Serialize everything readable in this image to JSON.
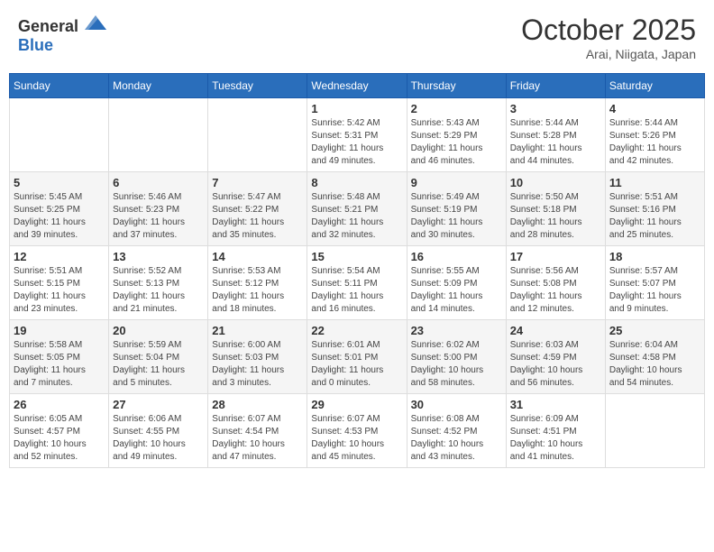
{
  "header": {
    "logo_general": "General",
    "logo_blue": "Blue",
    "month": "October 2025",
    "location": "Arai, Niigata, Japan"
  },
  "weekdays": [
    "Sunday",
    "Monday",
    "Tuesday",
    "Wednesday",
    "Thursday",
    "Friday",
    "Saturday"
  ],
  "weeks": [
    [
      {
        "day": "",
        "info": ""
      },
      {
        "day": "",
        "info": ""
      },
      {
        "day": "",
        "info": ""
      },
      {
        "day": "1",
        "info": "Sunrise: 5:42 AM\nSunset: 5:31 PM\nDaylight: 11 hours\nand 49 minutes."
      },
      {
        "day": "2",
        "info": "Sunrise: 5:43 AM\nSunset: 5:29 PM\nDaylight: 11 hours\nand 46 minutes."
      },
      {
        "day": "3",
        "info": "Sunrise: 5:44 AM\nSunset: 5:28 PM\nDaylight: 11 hours\nand 44 minutes."
      },
      {
        "day": "4",
        "info": "Sunrise: 5:44 AM\nSunset: 5:26 PM\nDaylight: 11 hours\nand 42 minutes."
      }
    ],
    [
      {
        "day": "5",
        "info": "Sunrise: 5:45 AM\nSunset: 5:25 PM\nDaylight: 11 hours\nand 39 minutes."
      },
      {
        "day": "6",
        "info": "Sunrise: 5:46 AM\nSunset: 5:23 PM\nDaylight: 11 hours\nand 37 minutes."
      },
      {
        "day": "7",
        "info": "Sunrise: 5:47 AM\nSunset: 5:22 PM\nDaylight: 11 hours\nand 35 minutes."
      },
      {
        "day": "8",
        "info": "Sunrise: 5:48 AM\nSunset: 5:21 PM\nDaylight: 11 hours\nand 32 minutes."
      },
      {
        "day": "9",
        "info": "Sunrise: 5:49 AM\nSunset: 5:19 PM\nDaylight: 11 hours\nand 30 minutes."
      },
      {
        "day": "10",
        "info": "Sunrise: 5:50 AM\nSunset: 5:18 PM\nDaylight: 11 hours\nand 28 minutes."
      },
      {
        "day": "11",
        "info": "Sunrise: 5:51 AM\nSunset: 5:16 PM\nDaylight: 11 hours\nand 25 minutes."
      }
    ],
    [
      {
        "day": "12",
        "info": "Sunrise: 5:51 AM\nSunset: 5:15 PM\nDaylight: 11 hours\nand 23 minutes."
      },
      {
        "day": "13",
        "info": "Sunrise: 5:52 AM\nSunset: 5:13 PM\nDaylight: 11 hours\nand 21 minutes."
      },
      {
        "day": "14",
        "info": "Sunrise: 5:53 AM\nSunset: 5:12 PM\nDaylight: 11 hours\nand 18 minutes."
      },
      {
        "day": "15",
        "info": "Sunrise: 5:54 AM\nSunset: 5:11 PM\nDaylight: 11 hours\nand 16 minutes."
      },
      {
        "day": "16",
        "info": "Sunrise: 5:55 AM\nSunset: 5:09 PM\nDaylight: 11 hours\nand 14 minutes."
      },
      {
        "day": "17",
        "info": "Sunrise: 5:56 AM\nSunset: 5:08 PM\nDaylight: 11 hours\nand 12 minutes."
      },
      {
        "day": "18",
        "info": "Sunrise: 5:57 AM\nSunset: 5:07 PM\nDaylight: 11 hours\nand 9 minutes."
      }
    ],
    [
      {
        "day": "19",
        "info": "Sunrise: 5:58 AM\nSunset: 5:05 PM\nDaylight: 11 hours\nand 7 minutes."
      },
      {
        "day": "20",
        "info": "Sunrise: 5:59 AM\nSunset: 5:04 PM\nDaylight: 11 hours\nand 5 minutes."
      },
      {
        "day": "21",
        "info": "Sunrise: 6:00 AM\nSunset: 5:03 PM\nDaylight: 11 hours\nand 3 minutes."
      },
      {
        "day": "22",
        "info": "Sunrise: 6:01 AM\nSunset: 5:01 PM\nDaylight: 11 hours\nand 0 minutes."
      },
      {
        "day": "23",
        "info": "Sunrise: 6:02 AM\nSunset: 5:00 PM\nDaylight: 10 hours\nand 58 minutes."
      },
      {
        "day": "24",
        "info": "Sunrise: 6:03 AM\nSunset: 4:59 PM\nDaylight: 10 hours\nand 56 minutes."
      },
      {
        "day": "25",
        "info": "Sunrise: 6:04 AM\nSunset: 4:58 PM\nDaylight: 10 hours\nand 54 minutes."
      }
    ],
    [
      {
        "day": "26",
        "info": "Sunrise: 6:05 AM\nSunset: 4:57 PM\nDaylight: 10 hours\nand 52 minutes."
      },
      {
        "day": "27",
        "info": "Sunrise: 6:06 AM\nSunset: 4:55 PM\nDaylight: 10 hours\nand 49 minutes."
      },
      {
        "day": "28",
        "info": "Sunrise: 6:07 AM\nSunset: 4:54 PM\nDaylight: 10 hours\nand 47 minutes."
      },
      {
        "day": "29",
        "info": "Sunrise: 6:07 AM\nSunset: 4:53 PM\nDaylight: 10 hours\nand 45 minutes."
      },
      {
        "day": "30",
        "info": "Sunrise: 6:08 AM\nSunset: 4:52 PM\nDaylight: 10 hours\nand 43 minutes."
      },
      {
        "day": "31",
        "info": "Sunrise: 6:09 AM\nSunset: 4:51 PM\nDaylight: 10 hours\nand 41 minutes."
      },
      {
        "day": "",
        "info": ""
      }
    ]
  ]
}
